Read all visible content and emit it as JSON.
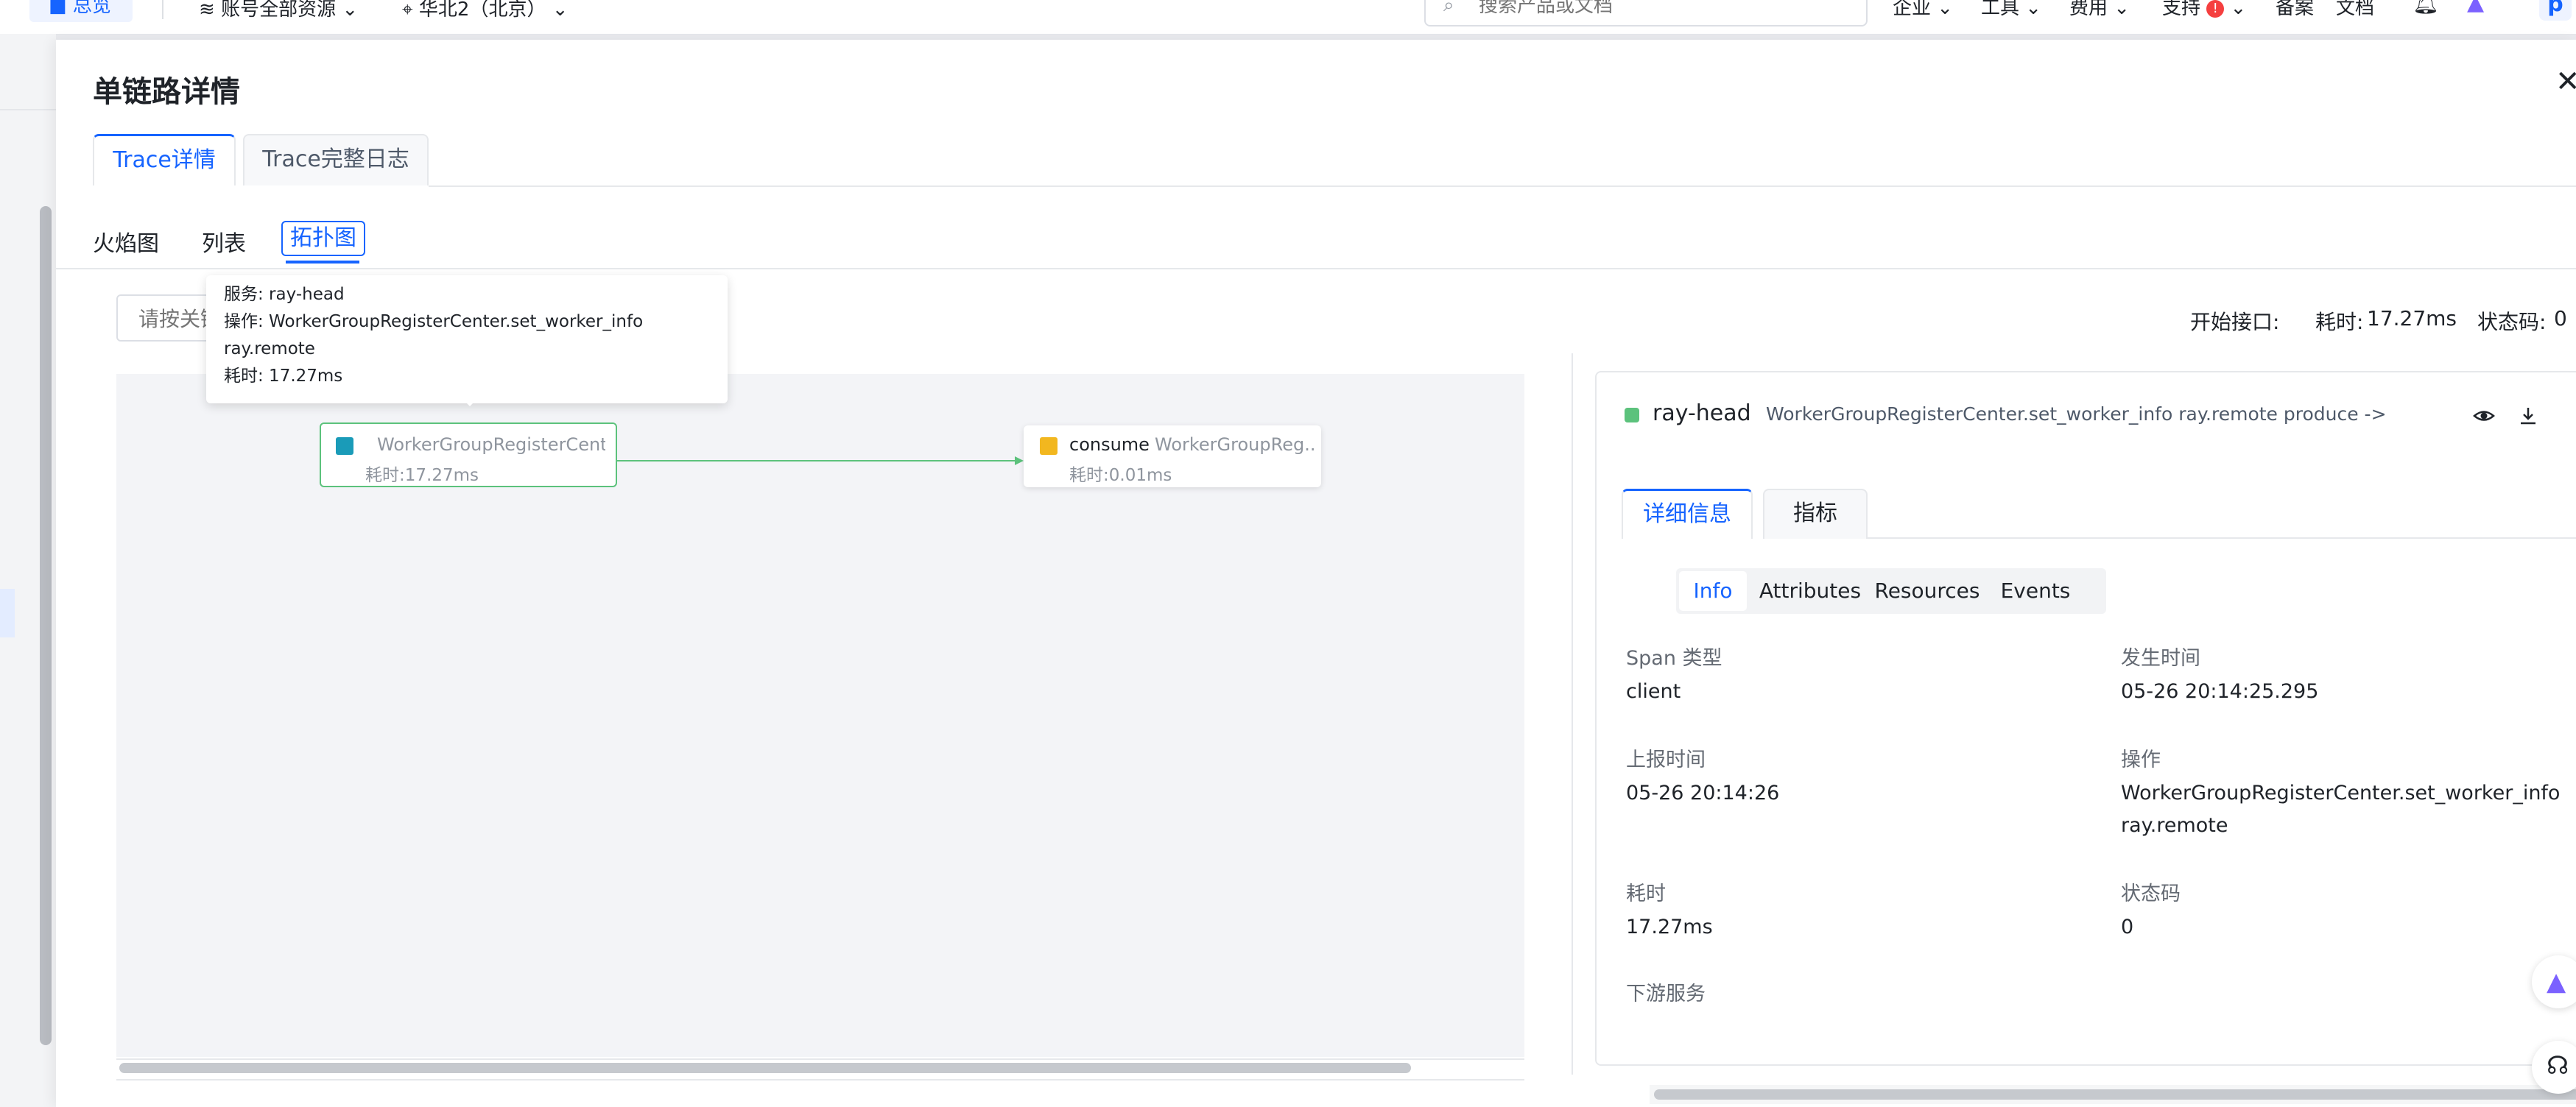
{
  "topbar": {
    "home_label": "总览",
    "resource_scope": "账号全部资源",
    "region": "华北2（北京）",
    "search_placeholder": "搜索产品或文档",
    "nav": [
      "企业",
      "工具",
      "费用",
      "支持",
      "备案",
      "文档"
    ],
    "support_badge": "!",
    "avatar_letter": "p"
  },
  "drawer": {
    "title": "单链路详情",
    "tabs": [
      "Trace详情",
      "Trace完整日志"
    ],
    "view_tabs": [
      "火焰图",
      "列表",
      "拓扑图"
    ],
    "active_view": "拓扑图",
    "keyword_placeholder": "请按关键字搜索",
    "summary": {
      "start_api_label": "开始接口:",
      "start_api_value": "",
      "duration_label": "耗时:",
      "duration_value": "17.27ms",
      "status_label": "状态码:",
      "status_value": "0"
    }
  },
  "topology": {
    "nodes": [
      {
        "service": "",
        "operation": "WorkerGroupRegisterCent...",
        "duration": "耗时:17.27ms",
        "color": "#1a9bb8"
      },
      {
        "service": "consume",
        "operation": "WorkerGroupReg...",
        "duration": "耗时:0.01ms",
        "color": "#f2b71f"
      }
    ],
    "tooltip": {
      "service": "服务: ray-head",
      "operation": "操作: WorkerGroupRegisterCenter.set_worker_info",
      "operation_cont": "ray.remote",
      "duration": "耗时: 17.27ms"
    },
    "edge_color": "#5cc27c"
  },
  "detail": {
    "service": "ray-head",
    "operation": "WorkerGroupRegisterCenter.set_worker_info ray.remote produce ->",
    "tabs": [
      "详细信息",
      "指标"
    ],
    "segments": [
      "Info",
      "Attributes",
      "Resources",
      "Events"
    ],
    "fields": {
      "span_type_label": "Span 类型",
      "span_type_value": "client",
      "occur_time_label": "发生时间",
      "occur_time_value": "05-26 20:14:25.295",
      "report_time_label": "上报时间",
      "report_time_value": "05-26 20:14:26",
      "operation_label": "操作",
      "operation_value_1": "WorkerGroupRegisterCenter.set_worker_info",
      "operation_value_2": "ray.remote",
      "duration_label": "耗时",
      "duration_value": "17.27ms",
      "status_label": "状态码",
      "status_value": "0",
      "downstream_label": "下游服务"
    }
  },
  "colors": {
    "accent": "#1664ff",
    "service_dot": "#5cc27c"
  }
}
